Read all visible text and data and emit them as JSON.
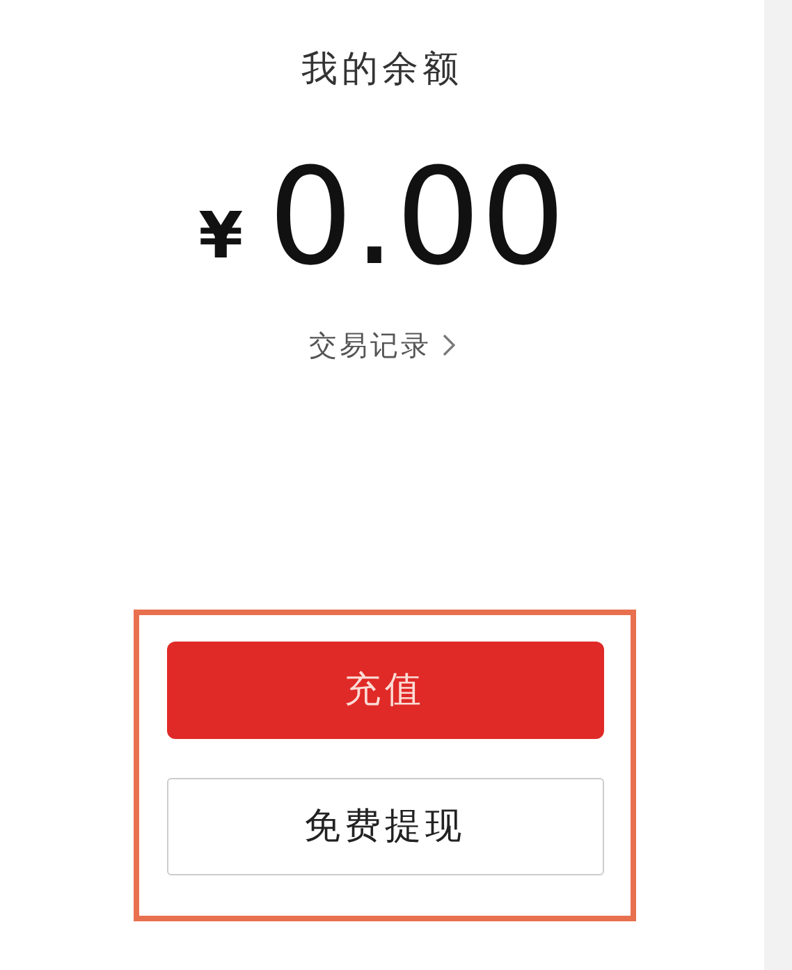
{
  "title": "我的余额",
  "balance": {
    "currency": "¥",
    "amount": "0.00"
  },
  "records_link": {
    "label": "交易记录"
  },
  "buttons": [
    {
      "kind": "primary",
      "label": "充值"
    },
    {
      "kind": "secondary",
      "label": "免费提现"
    }
  ]
}
